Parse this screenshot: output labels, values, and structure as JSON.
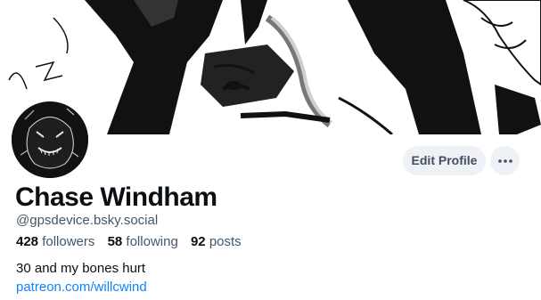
{
  "profile": {
    "display_name": "Chase Windham",
    "handle": "@gpsdevice.bsky.social",
    "followers_count": "428",
    "followers_label": "followers",
    "following_count": "58",
    "following_label": "following",
    "posts_count": "92",
    "posts_label": "posts",
    "bio": "30 and my bones hurt",
    "link": "patreon.com/willcwind"
  },
  "actions": {
    "edit_profile_label": "Edit Profile",
    "more_icon": "ellipsis-icon"
  },
  "colors": {
    "accent_link": "#1083fe",
    "button_bg": "#eef1f5",
    "muted_text": "#42576c"
  }
}
